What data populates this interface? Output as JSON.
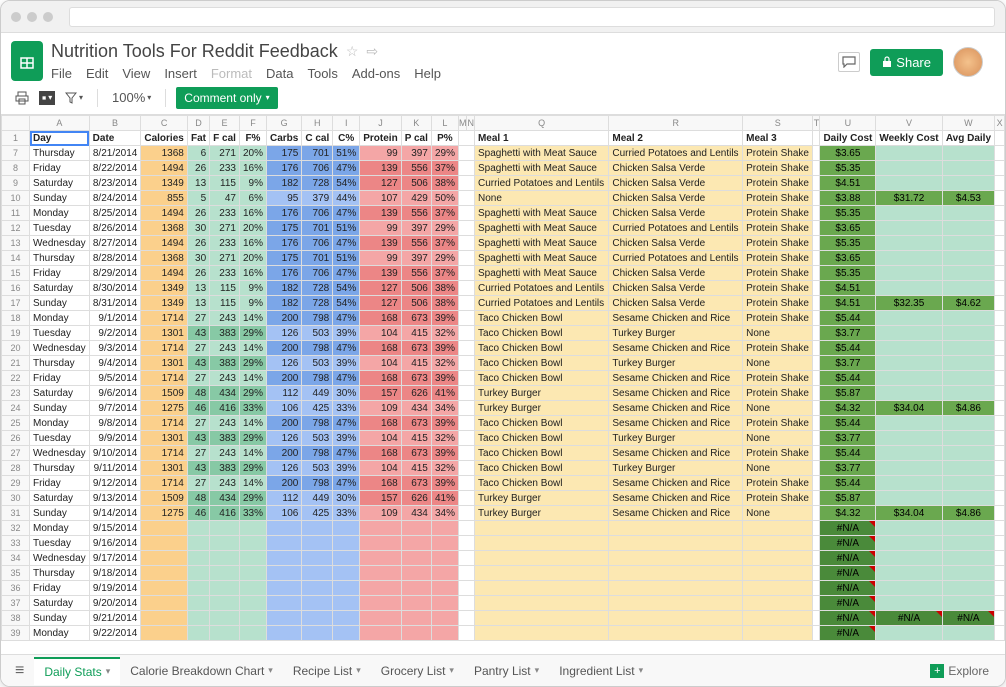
{
  "doc": {
    "title": "Nutrition Tools For Reddit Feedback"
  },
  "menus": [
    "File",
    "Edit",
    "View",
    "Insert",
    "Format",
    "Data",
    "Tools",
    "Add-ons",
    "Help"
  ],
  "menus_disabled_idx": [
    4
  ],
  "toolbar": {
    "zoom": "100%",
    "mode": "Comment only"
  },
  "share_label": "Share",
  "columns": [
    "",
    "A",
    "B",
    "C",
    "D",
    "E",
    "F",
    "G",
    "H",
    "I",
    "J",
    "K",
    "L",
    "M",
    "N",
    "Q",
    "R",
    "S",
    "T",
    "U",
    "V",
    "W",
    "X"
  ],
  "col_classes": [
    "rowhead",
    "colA",
    "colB",
    "colC",
    "colD",
    "colE",
    "colF",
    "colG",
    "colH",
    "colI",
    "colJ",
    "colK",
    "colL",
    "",
    "",
    "colQ",
    "colR",
    "colS",
    "colT",
    "colU",
    "colV",
    "colW",
    "colX"
  ],
  "visible_labels_mn": [
    "M",
    "N"
  ],
  "header_row_num": "1",
  "headers": [
    "Day",
    "Date",
    "Calories",
    "Fat",
    "F cal",
    "F%",
    "Carbs",
    "C cal",
    "C%",
    "Protein",
    "P cal",
    "P%",
    "Meal 1",
    "Meal 2",
    "Meal 3",
    "Daily Cost",
    "Weekly Cost",
    "Avg Daily"
  ],
  "rows": [
    {
      "n": "7",
      "day": "Thursday",
      "date": "8/21/2014",
      "cal": 1368,
      "fat": 6,
      "fcal": 271,
      "fpct": "20%",
      "carb": 175,
      "ccal": 701,
      "cpct": "51%",
      "prot": 99,
      "pcal": 397,
      "ppct": "29%",
      "m1": "Spaghetti with Meat Sauce",
      "m2": "Curried Potatoes and Lentils",
      "m3": "Protein Shake",
      "dc": "$3.65",
      "wc": "",
      "ad": ""
    },
    {
      "n": "8",
      "day": "Friday",
      "date": "8/22/2014",
      "cal": 1494,
      "fat": 26,
      "fcal": 233,
      "fpct": "16%",
      "carb": 176,
      "ccal": 706,
      "cpct": "47%",
      "prot": 139,
      "pcal": 556,
      "ppct": "37%",
      "m1": "Spaghetti with Meat Sauce",
      "m2": "Chicken Salsa Verde",
      "m3": "Protein Shake",
      "dc": "$5.35",
      "wc": "",
      "ad": ""
    },
    {
      "n": "9",
      "day": "Saturday",
      "date": "8/23/2014",
      "cal": 1349,
      "fat": 13,
      "fcal": 115,
      "fpct": "9%",
      "carb": 182,
      "ccal": 728,
      "cpct": "54%",
      "prot": 127,
      "pcal": 506,
      "ppct": "38%",
      "m1": "Curried Potatoes and Lentils",
      "m2": "Chicken Salsa Verde",
      "m3": "Protein Shake",
      "dc": "$4.51",
      "wc": "",
      "ad": ""
    },
    {
      "n": "10",
      "day": "Sunday",
      "date": "8/24/2014",
      "cal": 855,
      "fat": 5,
      "fcal": 47,
      "fpct": "6%",
      "carb": 95,
      "ccal": 379,
      "cpct": "44%",
      "prot": 107,
      "pcal": 429,
      "ppct": "50%",
      "m1": "None",
      "m2": "Chicken Salsa Verde",
      "m3": "Protein Shake",
      "dc": "$3.88",
      "wc": "$31.72",
      "ad": "$4.53"
    },
    {
      "n": "11",
      "day": "Monday",
      "date": "8/25/2014",
      "cal": 1494,
      "fat": 26,
      "fcal": 233,
      "fpct": "16%",
      "carb": 176,
      "ccal": 706,
      "cpct": "47%",
      "prot": 139,
      "pcal": 556,
      "ppct": "37%",
      "m1": "Spaghetti with Meat Sauce",
      "m2": "Chicken Salsa Verde",
      "m3": "Protein Shake",
      "dc": "$5.35",
      "wc": "",
      "ad": ""
    },
    {
      "n": "12",
      "day": "Tuesday",
      "date": "8/26/2014",
      "cal": 1368,
      "fat": 30,
      "fcal": 271,
      "fpct": "20%",
      "carb": 175,
      "ccal": 701,
      "cpct": "51%",
      "prot": 99,
      "pcal": 397,
      "ppct": "29%",
      "m1": "Spaghetti with Meat Sauce",
      "m2": "Curried Potatoes and Lentils",
      "m3": "Protein Shake",
      "dc": "$3.65",
      "wc": "",
      "ad": ""
    },
    {
      "n": "13",
      "day": "Wednesday",
      "date": "8/27/2014",
      "cal": 1494,
      "fat": 26,
      "fcal": 233,
      "fpct": "16%",
      "carb": 176,
      "ccal": 706,
      "cpct": "47%",
      "prot": 139,
      "pcal": 556,
      "ppct": "37%",
      "m1": "Spaghetti with Meat Sauce",
      "m2": "Chicken Salsa Verde",
      "m3": "Protein Shake",
      "dc": "$5.35",
      "wc": "",
      "ad": ""
    },
    {
      "n": "14",
      "day": "Thursday",
      "date": "8/28/2014",
      "cal": 1368,
      "fat": 30,
      "fcal": 271,
      "fpct": "20%",
      "carb": 175,
      "ccal": 701,
      "cpct": "51%",
      "prot": 99,
      "pcal": 397,
      "ppct": "29%",
      "m1": "Spaghetti with Meat Sauce",
      "m2": "Curried Potatoes and Lentils",
      "m3": "Protein Shake",
      "dc": "$3.65",
      "wc": "",
      "ad": ""
    },
    {
      "n": "15",
      "day": "Friday",
      "date": "8/29/2014",
      "cal": 1494,
      "fat": 26,
      "fcal": 233,
      "fpct": "16%",
      "carb": 176,
      "ccal": 706,
      "cpct": "47%",
      "prot": 139,
      "pcal": 556,
      "ppct": "37%",
      "m1": "Spaghetti with Meat Sauce",
      "m2": "Chicken Salsa Verde",
      "m3": "Protein Shake",
      "dc": "$5.35",
      "wc": "",
      "ad": ""
    },
    {
      "n": "16",
      "day": "Saturday",
      "date": "8/30/2014",
      "cal": 1349,
      "fat": 13,
      "fcal": 115,
      "fpct": "9%",
      "carb": 182,
      "ccal": 728,
      "cpct": "54%",
      "prot": 127,
      "pcal": 506,
      "ppct": "38%",
      "m1": "Curried Potatoes and Lentils",
      "m2": "Chicken Salsa Verde",
      "m3": "Protein Shake",
      "dc": "$4.51",
      "wc": "",
      "ad": ""
    },
    {
      "n": "17",
      "day": "Sunday",
      "date": "8/31/2014",
      "cal": 1349,
      "fat": 13,
      "fcal": 115,
      "fpct": "9%",
      "carb": 182,
      "ccal": 728,
      "cpct": "54%",
      "prot": 127,
      "pcal": 506,
      "ppct": "38%",
      "m1": "Curried Potatoes and Lentils",
      "m2": "Chicken Salsa Verde",
      "m3": "Protein Shake",
      "dc": "$4.51",
      "wc": "$32.35",
      "ad": "$4.62"
    },
    {
      "n": "18",
      "day": "Monday",
      "date": "9/1/2014",
      "cal": 1714,
      "fat": 27,
      "fcal": 243,
      "fpct": "14%",
      "carb": 200,
      "ccal": 798,
      "cpct": "47%",
      "prot": 168,
      "pcal": 673,
      "ppct": "39%",
      "m1": "Taco Chicken Bowl",
      "m2": "Sesame Chicken and Rice",
      "m3": "Protein Shake",
      "dc": "$5.44",
      "wc": "",
      "ad": ""
    },
    {
      "n": "19",
      "day": "Tuesday",
      "date": "9/2/2014",
      "cal": 1301,
      "fat": 43,
      "fcal": 383,
      "fpct": "29%",
      "carb": 126,
      "ccal": 503,
      "cpct": "39%",
      "prot": 104,
      "pcal": 415,
      "ppct": "32%",
      "m1": "Taco Chicken Bowl",
      "m2": "Turkey Burger",
      "m3": "None",
      "dc": "$3.77",
      "wc": "",
      "ad": ""
    },
    {
      "n": "20",
      "day": "Wednesday",
      "date": "9/3/2014",
      "cal": 1714,
      "fat": 27,
      "fcal": 243,
      "fpct": "14%",
      "carb": 200,
      "ccal": 798,
      "cpct": "47%",
      "prot": 168,
      "pcal": 673,
      "ppct": "39%",
      "m1": "Taco Chicken Bowl",
      "m2": "Sesame Chicken and Rice",
      "m3": "Protein Shake",
      "dc": "$5.44",
      "wc": "",
      "ad": ""
    },
    {
      "n": "21",
      "day": "Thursday",
      "date": "9/4/2014",
      "cal": 1301,
      "fat": 43,
      "fcal": 383,
      "fpct": "29%",
      "carb": 126,
      "ccal": 503,
      "cpct": "39%",
      "prot": 104,
      "pcal": 415,
      "ppct": "32%",
      "m1": "Taco Chicken Bowl",
      "m2": "Turkey Burger",
      "m3": "None",
      "dc": "$3.77",
      "wc": "",
      "ad": ""
    },
    {
      "n": "22",
      "day": "Friday",
      "date": "9/5/2014",
      "cal": 1714,
      "fat": 27,
      "fcal": 243,
      "fpct": "14%",
      "carb": 200,
      "ccal": 798,
      "cpct": "47%",
      "prot": 168,
      "pcal": 673,
      "ppct": "39%",
      "m1": "Taco Chicken Bowl",
      "m2": "Sesame Chicken and Rice",
      "m3": "Protein Shake",
      "dc": "$5.44",
      "wc": "",
      "ad": ""
    },
    {
      "n": "23",
      "day": "Saturday",
      "date": "9/6/2014",
      "cal": 1509,
      "fat": 48,
      "fcal": 434,
      "fpct": "29%",
      "carb": 112,
      "ccal": 449,
      "cpct": "30%",
      "prot": 157,
      "pcal": 626,
      "ppct": "41%",
      "m1": "Turkey Burger",
      "m2": "Sesame Chicken and Rice",
      "m3": "Protein Shake",
      "dc": "$5.87",
      "wc": "",
      "ad": ""
    },
    {
      "n": "24",
      "day": "Sunday",
      "date": "9/7/2014",
      "cal": 1275,
      "fat": 46,
      "fcal": 416,
      "fpct": "33%",
      "carb": 106,
      "ccal": 425,
      "cpct": "33%",
      "prot": 109,
      "pcal": 434,
      "ppct": "34%",
      "m1": "Turkey Burger",
      "m2": "Sesame Chicken and Rice",
      "m3": "None",
      "dc": "$4.32",
      "wc": "$34.04",
      "ad": "$4.86"
    },
    {
      "n": "25",
      "day": "Monday",
      "date": "9/8/2014",
      "cal": 1714,
      "fat": 27,
      "fcal": 243,
      "fpct": "14%",
      "carb": 200,
      "ccal": 798,
      "cpct": "47%",
      "prot": 168,
      "pcal": 673,
      "ppct": "39%",
      "m1": "Taco Chicken Bowl",
      "m2": "Sesame Chicken and Rice",
      "m3": "Protein Shake",
      "dc": "$5.44",
      "wc": "",
      "ad": ""
    },
    {
      "n": "26",
      "day": "Tuesday",
      "date": "9/9/2014",
      "cal": 1301,
      "fat": 43,
      "fcal": 383,
      "fpct": "29%",
      "carb": 126,
      "ccal": 503,
      "cpct": "39%",
      "prot": 104,
      "pcal": 415,
      "ppct": "32%",
      "m1": "Taco Chicken Bowl",
      "m2": "Turkey Burger",
      "m3": "None",
      "dc": "$3.77",
      "wc": "",
      "ad": ""
    },
    {
      "n": "27",
      "day": "Wednesday",
      "date": "9/10/2014",
      "cal": 1714,
      "fat": 27,
      "fcal": 243,
      "fpct": "14%",
      "carb": 200,
      "ccal": 798,
      "cpct": "47%",
      "prot": 168,
      "pcal": 673,
      "ppct": "39%",
      "m1": "Taco Chicken Bowl",
      "m2": "Sesame Chicken and Rice",
      "m3": "Protein Shake",
      "dc": "$5.44",
      "wc": "",
      "ad": ""
    },
    {
      "n": "28",
      "day": "Thursday",
      "date": "9/11/2014",
      "cal": 1301,
      "fat": 43,
      "fcal": 383,
      "fpct": "29%",
      "carb": 126,
      "ccal": 503,
      "cpct": "39%",
      "prot": 104,
      "pcal": 415,
      "ppct": "32%",
      "m1": "Taco Chicken Bowl",
      "m2": "Turkey Burger",
      "m3": "None",
      "dc": "$3.77",
      "wc": "",
      "ad": ""
    },
    {
      "n": "29",
      "day": "Friday",
      "date": "9/12/2014",
      "cal": 1714,
      "fat": 27,
      "fcal": 243,
      "fpct": "14%",
      "carb": 200,
      "ccal": 798,
      "cpct": "47%",
      "prot": 168,
      "pcal": 673,
      "ppct": "39%",
      "m1": "Taco Chicken Bowl",
      "m2": "Sesame Chicken and Rice",
      "m3": "Protein Shake",
      "dc": "$5.44",
      "wc": "",
      "ad": ""
    },
    {
      "n": "30",
      "day": "Saturday",
      "date": "9/13/2014",
      "cal": 1509,
      "fat": 48,
      "fcal": 434,
      "fpct": "29%",
      "carb": 112,
      "ccal": 449,
      "cpct": "30%",
      "prot": 157,
      "pcal": 626,
      "ppct": "41%",
      "m1": "Turkey Burger",
      "m2": "Sesame Chicken and Rice",
      "m3": "Protein Shake",
      "dc": "$5.87",
      "wc": "",
      "ad": ""
    },
    {
      "n": "31",
      "day": "Sunday",
      "date": "9/14/2014",
      "cal": 1275,
      "fat": 46,
      "fcal": 416,
      "fpct": "33%",
      "carb": 106,
      "ccal": 425,
      "cpct": "33%",
      "prot": 109,
      "pcal": 434,
      "ppct": "34%",
      "m1": "Turkey Burger",
      "m2": "Sesame Chicken and Rice",
      "m3": "None",
      "dc": "$4.32",
      "wc": "$34.04",
      "ad": "$4.86"
    }
  ],
  "empty_rows": [
    {
      "n": "32",
      "day": "Monday",
      "date": "9/15/2014",
      "sun": false
    },
    {
      "n": "33",
      "day": "Tuesday",
      "date": "9/16/2014",
      "sun": false
    },
    {
      "n": "34",
      "day": "Wednesday",
      "date": "9/17/2014",
      "sun": false
    },
    {
      "n": "35",
      "day": "Thursday",
      "date": "9/18/2014",
      "sun": false
    },
    {
      "n": "36",
      "day": "Friday",
      "date": "9/19/2014",
      "sun": false
    },
    {
      "n": "37",
      "day": "Saturday",
      "date": "9/20/2014",
      "sun": false
    },
    {
      "n": "38",
      "day": "Sunday",
      "date": "9/21/2014",
      "sun": true
    },
    {
      "n": "39",
      "day": "Monday",
      "date": "9/22/2014",
      "sun": false
    }
  ],
  "na": "#N/A",
  "tabs": [
    "Daily Stats",
    "Calorie Breakdown Chart",
    "Recipe List",
    "Grocery List",
    "Pantry List",
    "Ingredient List"
  ],
  "active_tab": 0,
  "explore_label": "Explore"
}
